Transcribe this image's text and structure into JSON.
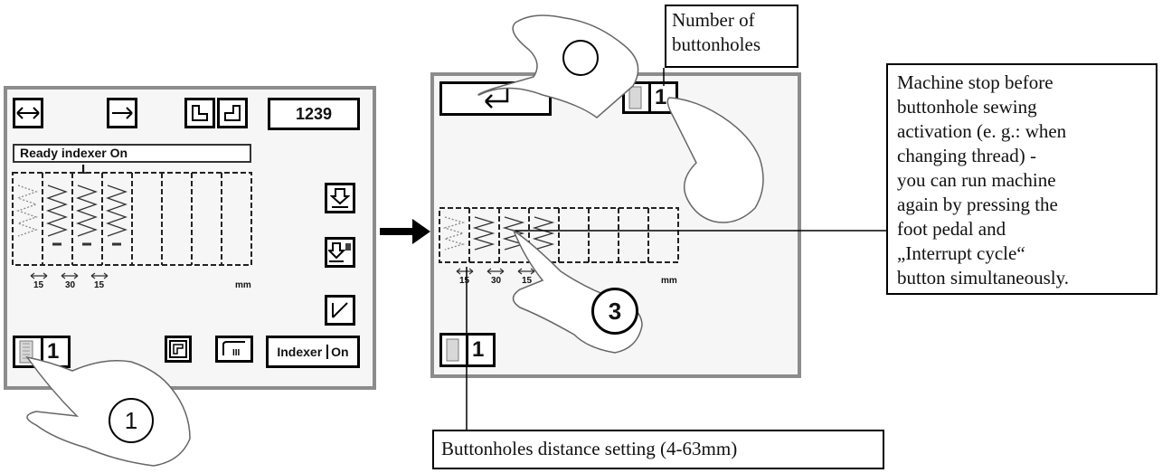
{
  "left_screen": {
    "counter": "1239",
    "status_text": "Ready indexer On",
    "marker": "L",
    "distances": [
      "15",
      "30",
      "15"
    ],
    "unit": "mm",
    "buttonhole_count": "1",
    "indexer_label": "Indexer",
    "indexer_state": "On",
    "step_label": "1"
  },
  "right_screen": {
    "buttonhole_count_top": "1",
    "buttonhole_count_bottom": "1",
    "distances": [
      "15",
      "30",
      "15"
    ],
    "unit": "mm",
    "step_label": "3"
  },
  "callouts": {
    "number_of_buttonholes": [
      "Number of",
      "buttonholes"
    ],
    "machine_stop": [
      "Machine stop before",
      "buttonhole sewing",
      "activation (e. g.: when",
      "changing thread) -",
      "you can run machine",
      "again by pressing the",
      "foot pedal and",
      "„Interrupt cycle“",
      "button simultaneously."
    ],
    "distance_setting": "Buttonholes distance setting (4-63mm)"
  }
}
